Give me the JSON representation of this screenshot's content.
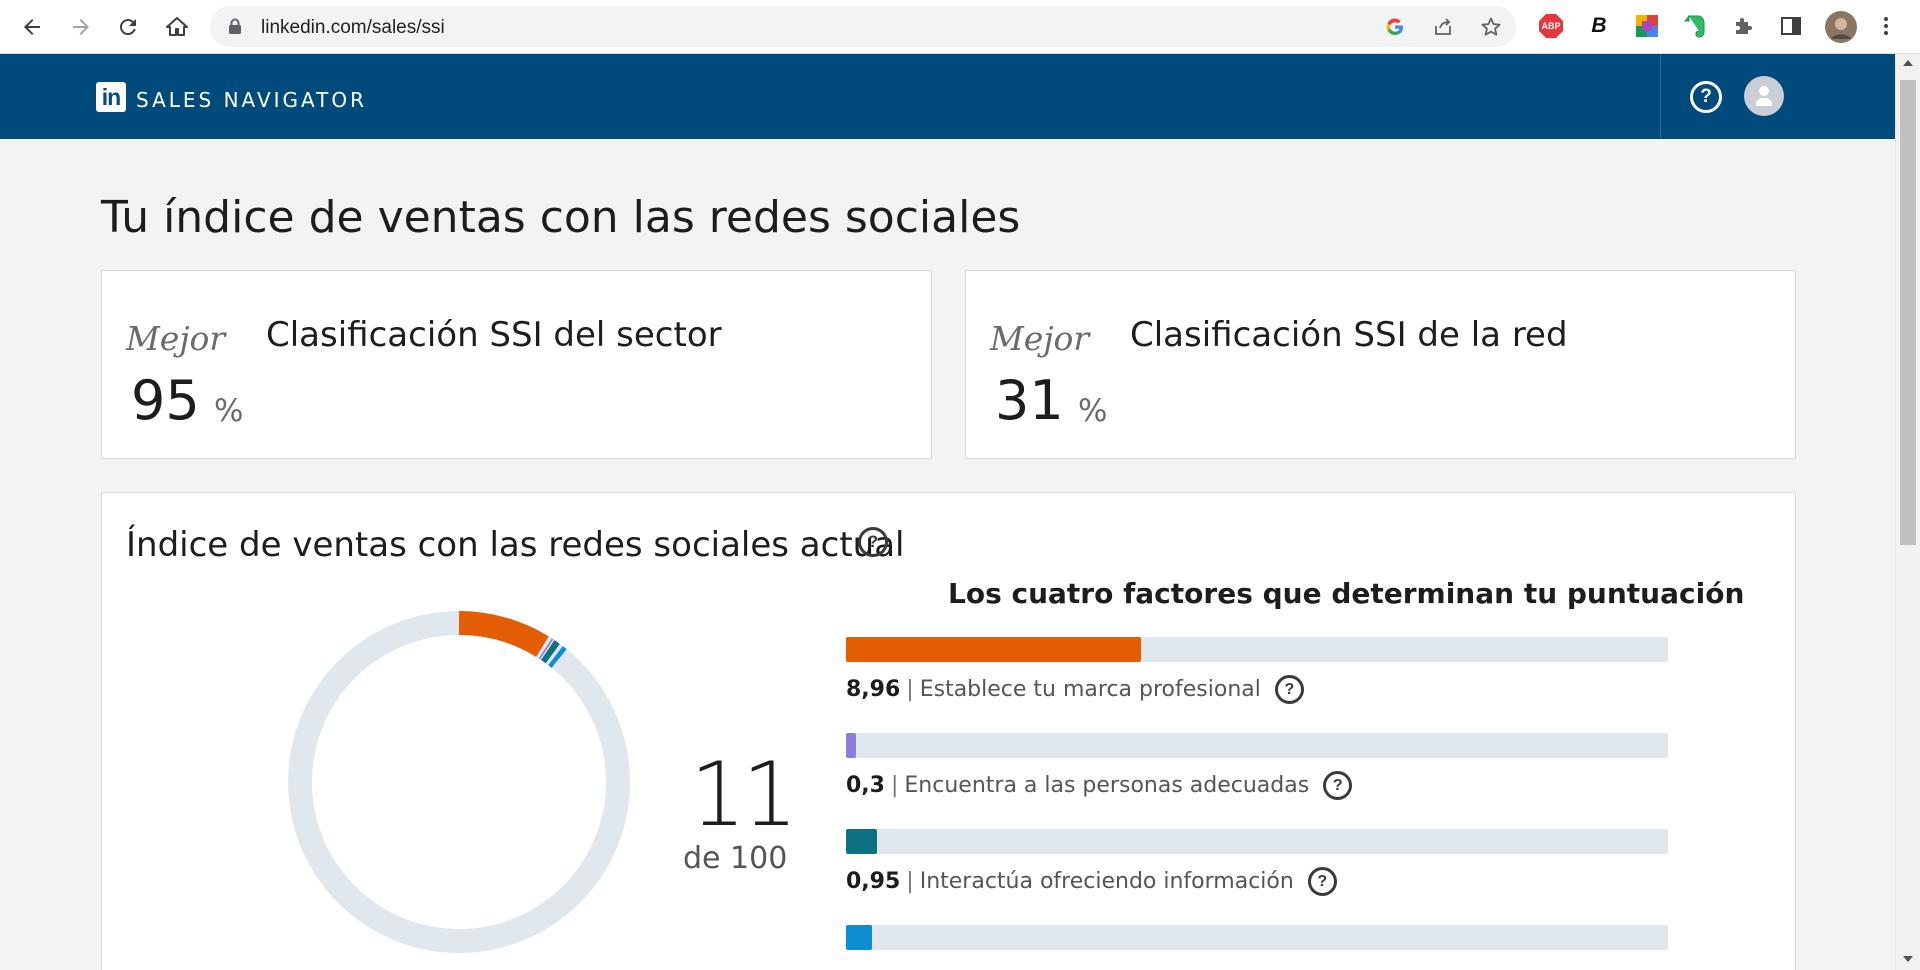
{
  "browser": {
    "url": "linkedin.com/sales/ssi"
  },
  "extensions": {
    "abp_label": "ABP",
    "b_label": "B"
  },
  "app": {
    "brand": "SALES NAVIGATOR",
    "logo_text": "in",
    "help_label": "?"
  },
  "page": {
    "title": "Tu índice de ventas con las redes sociales"
  },
  "rank_cards": [
    {
      "label": "Mejor",
      "value": "95",
      "unit": "%",
      "title": "Clasificación SSI del sector"
    },
    {
      "label": "Mejor",
      "value": "31",
      "unit": "%",
      "title": "Clasificación SSI de la red"
    }
  ],
  "ssi": {
    "title": "Índice de ventas con las redes sociales actual",
    "score": "11",
    "of": "de 100",
    "score_value": 11,
    "max": 100,
    "factors_title": "Los cuatro factores que determinan tu puntuación",
    "factors": [
      {
        "value": "8,96",
        "label": "Establece tu marca profesional",
        "score": 8.96,
        "max": 25,
        "color": "#e35d04"
      },
      {
        "value": "0,3",
        "label": "Encuentra a las personas adecuadas",
        "score": 0.3,
        "max": 25,
        "color": "#8b7fdc"
      },
      {
        "value": "0,95",
        "label": "Interactúa ofreciendo información",
        "score": 0.95,
        "max": 25,
        "color": "#0e7182"
      },
      {
        "value": "",
        "label": "",
        "score": 0.8,
        "max": 25,
        "color": "#0c8ed1"
      }
    ]
  },
  "colors": {
    "appbar": "#004b7c",
    "ring_track": "#e1e8ed"
  }
}
